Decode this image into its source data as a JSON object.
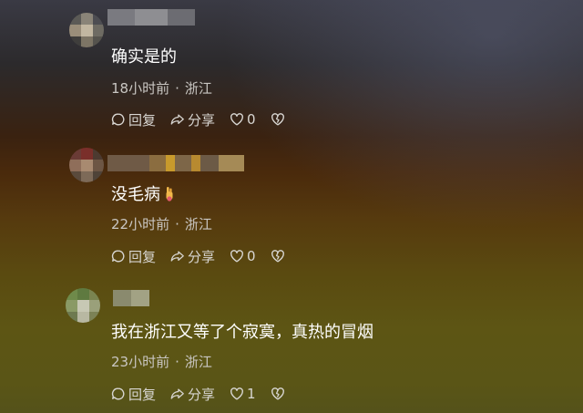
{
  "comments": [
    {
      "text": "确实是的",
      "time": "18小时前",
      "separator": "·",
      "location": "浙江",
      "reply_label": "回复",
      "share_label": "分享",
      "like_count": "0",
      "emoji": ""
    },
    {
      "text": "没毛病",
      "time": "22小时前",
      "separator": "·",
      "location": "浙江",
      "reply_label": "回复",
      "share_label": "分享",
      "like_count": "0",
      "emoji": "hand-emoji"
    },
    {
      "text": "我在浙江又等了个寂寞，真热的冒烟",
      "time": "23小时前",
      "separator": "·",
      "location": "浙江",
      "reply_label": "回复",
      "share_label": "分享",
      "like_count": "1",
      "emoji": ""
    }
  ],
  "icons": {
    "reply": "reply-icon",
    "share": "share-icon",
    "like": "heart-icon",
    "dislike": "broken-heart-icon"
  }
}
